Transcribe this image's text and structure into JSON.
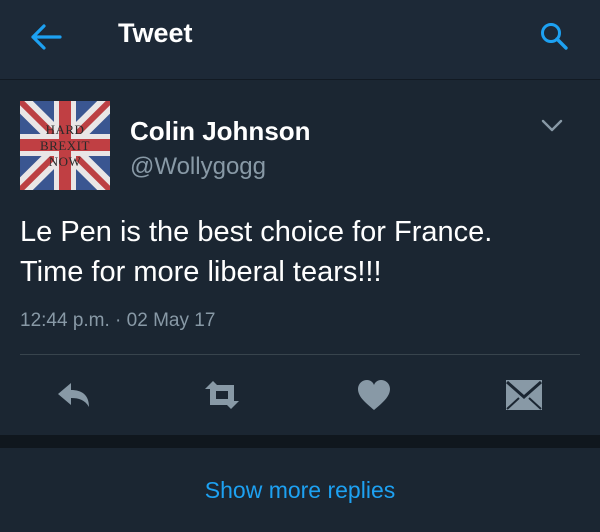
{
  "header": {
    "title": "Tweet",
    "back_icon": "arrow-left-icon",
    "search_icon": "search-icon",
    "accent_color": "#1da1f2"
  },
  "tweet": {
    "avatar_lines": [
      "HARD",
      "BREXIT",
      "NOW"
    ],
    "display_name": "Colin Johnson",
    "handle": "@Wollygogg",
    "text_line1": "Le Pen is the best choice for France.",
    "text_line2": "Time for more liberal tears!!!",
    "timestamp": "12:44 p.m. · 02 May 17"
  },
  "actions": [
    "reply-icon",
    "retweet-icon",
    "like-icon",
    "direct-message-icon"
  ],
  "footer": {
    "more_replies": "Show more replies"
  }
}
